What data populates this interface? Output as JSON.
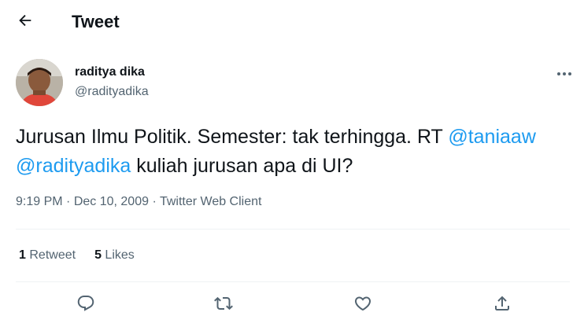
{
  "header": {
    "title": "Tweet",
    "back_icon": "arrow-left-icon"
  },
  "author": {
    "name": "raditya dika",
    "handle": "@radityadika",
    "more_icon": "more-horizontal-icon"
  },
  "tweet": {
    "text_part1": "Jurusan Ilmu Politik. Semester: tak terhingga. RT ",
    "mention1": "@taniaaw",
    "space": " ",
    "mention2": "@radityadika",
    "text_part2": " kuliah jurusan apa di UI?"
  },
  "meta": {
    "time": "9:19 PM",
    "separator": " · ",
    "date": "Dec 10, 2009",
    "source": "Twitter Web Client"
  },
  "stats": {
    "retweet_count": "1",
    "retweet_label": "Retweet",
    "likes_count": "5",
    "likes_label": "Likes"
  },
  "actions": [
    "reply-icon",
    "retweet-icon",
    "like-icon",
    "share-icon"
  ],
  "colors": {
    "accent": "#1d9bf0",
    "text": "#0f1419",
    "secondary": "#536471",
    "divider": "#eff3f4"
  }
}
